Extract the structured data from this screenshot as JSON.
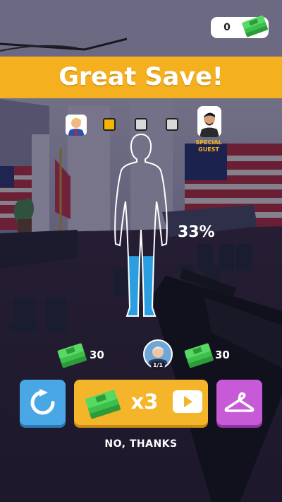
{
  "wallet": {
    "count": "0",
    "icon": "cash-stack-icon"
  },
  "banner": {
    "title": "Great Save!",
    "color": "#f5b020"
  },
  "progress": {
    "start_avatar_icon": "politician-avatar-icon",
    "slots": [
      "filled",
      "empty",
      "empty"
    ],
    "end_avatar_icon": "special-guest-avatar-icon",
    "guest_label_line1": "SPECIAL",
    "guest_label_line2": "GUEST"
  },
  "unlock": {
    "percent_label": "33%",
    "fill_fraction": 0.33,
    "fill_color": "#2a9ee0"
  },
  "rewards": {
    "left_amount": "30",
    "boss_count": "1/1",
    "right_amount": "30"
  },
  "actions": {
    "replay_icon": "replay-icon",
    "multiplier_label": "x3",
    "multiplier_icon": "video-play-icon",
    "hanger_icon": "hanger-icon",
    "no_thanks": "NO, THANKS"
  }
}
